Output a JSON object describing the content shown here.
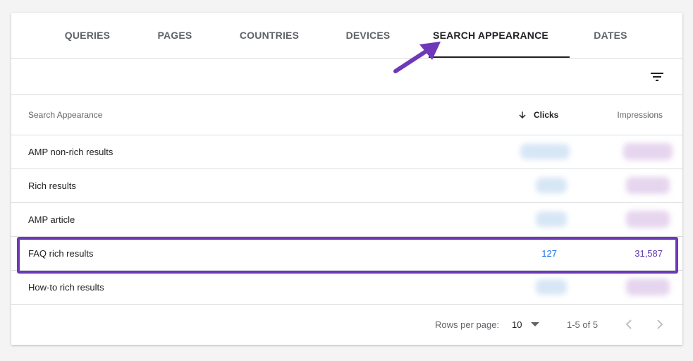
{
  "tabs": [
    {
      "label": "QUERIES",
      "active": false
    },
    {
      "label": "PAGES",
      "active": false
    },
    {
      "label": "COUNTRIES",
      "active": false
    },
    {
      "label": "DEVICES",
      "active": false
    },
    {
      "label": "SEARCH APPEARANCE",
      "active": true
    },
    {
      "label": "DATES",
      "active": false
    }
  ],
  "toolbar": {
    "filter_icon": "filter-list-icon"
  },
  "table": {
    "headers": {
      "search_appearance": "Search Appearance",
      "clicks": "Clicks",
      "impressions": "Impressions",
      "sort_icon": "arrow-down-icon"
    },
    "rows": [
      {
        "label": "AMP non-rich results",
        "clicks": "",
        "impressions": ""
      },
      {
        "label": "Rich results",
        "clicks": "",
        "impressions": ""
      },
      {
        "label": "AMP article",
        "clicks": "",
        "impressions": ""
      },
      {
        "label": "FAQ rich results",
        "clicks": "127",
        "impressions": "31,587"
      },
      {
        "label": "How-to rich results",
        "clicks": "",
        "impressions": ""
      }
    ]
  },
  "footer": {
    "rows_per_page_label": "Rows per page:",
    "rows_per_page_value": "10",
    "range": "1-5 of 5"
  },
  "colors": {
    "clicks": "#1a73e8",
    "impressions": "#5e35b1",
    "highlight": "#6e38b8"
  }
}
